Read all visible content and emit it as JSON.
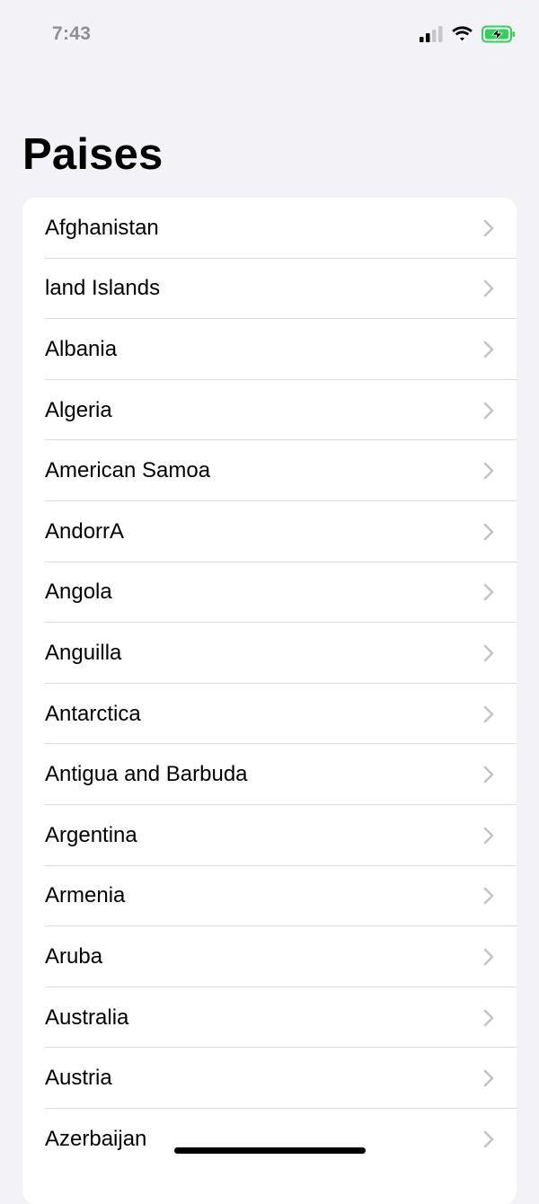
{
  "status_bar": {
    "time": "7:43",
    "icons": [
      "cellular-signal-icon",
      "wifi-icon",
      "battery-charging-icon"
    ],
    "battery_color": "#30d158"
  },
  "title": "Paises",
  "countries": [
    "Afghanistan",
    "land Islands",
    "Albania",
    "Algeria",
    "American Samoa",
    "AndorrA",
    "Angola",
    "Anguilla",
    "Antarctica",
    "Antigua and Barbuda",
    "Argentina",
    "Armenia",
    "Aruba",
    "Australia",
    "Austria",
    "Azerbaijan"
  ],
  "row_icon": "chevron-right-icon"
}
